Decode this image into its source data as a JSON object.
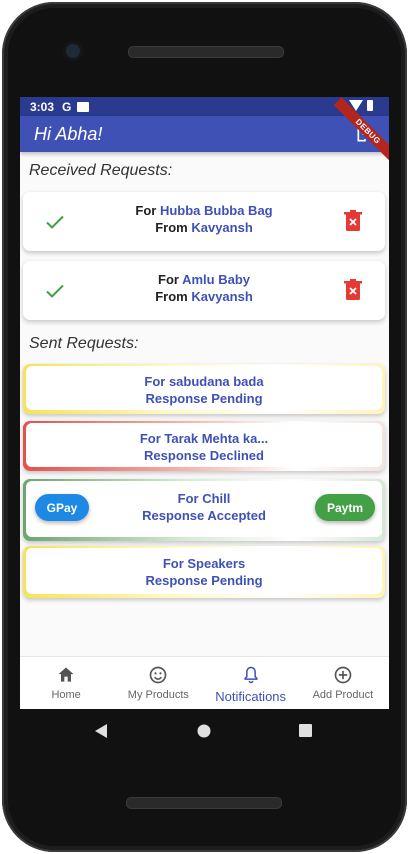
{
  "status": {
    "time": "3:03",
    "g": "G"
  },
  "appbar": {
    "title": "Hi Abha!",
    "debug_badge": "DEBUG"
  },
  "received": {
    "heading": "Received Requests:",
    "items": [
      {
        "for_label": "For",
        "item": "Hubba Bubba Bag",
        "from_label": "From",
        "name": "Kavyansh"
      },
      {
        "for_label": "For",
        "item": "Amlu Baby",
        "from_label": "From",
        "name": "Kavyansh"
      }
    ]
  },
  "sent": {
    "heading": "Sent Requests:",
    "items": [
      {
        "title": "For sabudana bada",
        "status": "Response Pending",
        "color": "#f6e25a"
      },
      {
        "title": "For Tarak Mehta ka...",
        "status": "Response Declined",
        "color": "#e1524a"
      },
      {
        "title": "For Chill",
        "status": "Response Accepted",
        "color": "#6aa66e",
        "left_button": "GPay",
        "right_button": "Paytm"
      },
      {
        "title": "For Speakers",
        "status": "Response Pending",
        "color": "#f6e25a"
      }
    ]
  },
  "bottom_nav": [
    {
      "label": "Home",
      "icon": "home-icon"
    },
    {
      "label": "My Products",
      "icon": "smiley-icon"
    },
    {
      "label": "Notifications",
      "icon": "bell-icon",
      "active": true
    },
    {
      "label": "Add Product",
      "icon": "add-circle-icon"
    }
  ],
  "colors": {
    "primary": "#3f51b5",
    "accept": "#43a047",
    "delete": "#e53935",
    "gpay": "#1e88e5"
  }
}
